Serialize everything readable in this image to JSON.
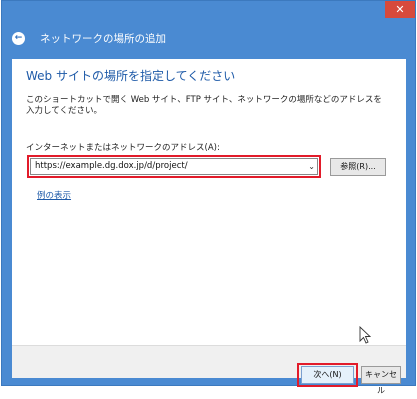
{
  "titlebar": {
    "close_label": "✕"
  },
  "header": {
    "back_label": "←",
    "title": "ネットワークの場所の追加"
  },
  "page": {
    "heading": "Web サイトの場所を指定してください",
    "description": "このショートカットで開く Web サイト、FTP サイト、ネットワークの場所などのアドレスを入力してください。",
    "field_label": "インターネットまたはネットワークのアドレス(A):",
    "address_value": "https://example.dg.dox.jp/d/project/",
    "browse_label": "参照(R)...",
    "example_link": "例の表示"
  },
  "footer": {
    "next_label": "次へ(N)",
    "cancel_label": "キャンセル"
  },
  "colors": {
    "frame": "#4a8ad2",
    "accent_text": "#1e5aa8",
    "highlight": "#e21b2a",
    "close": "#d74a3c"
  },
  "icons": {
    "back": "back-arrow-icon",
    "dropdown": "chevron-down-icon",
    "cursor": "mouse-pointer-icon"
  }
}
